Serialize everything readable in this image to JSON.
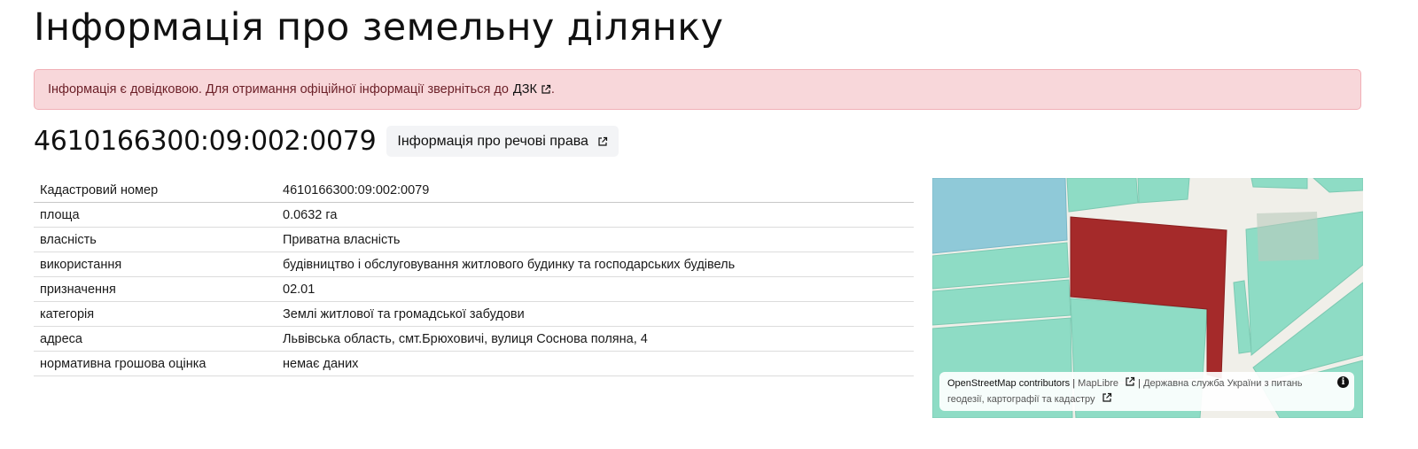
{
  "page": {
    "title": "Інформація про земельну ділянку"
  },
  "alert": {
    "text": "Інформація є довідковою. Для отримання офіційної інформації зверніться до",
    "link_label": "ДЗК",
    "suffix": "."
  },
  "parcel": {
    "cadastral_title": "4610166300:09:002:0079",
    "rights_button_label": "Інформація про речові права"
  },
  "info_table": [
    {
      "key": "Кадастровий номер",
      "value": "4610166300:09:002:0079"
    },
    {
      "key": "площа",
      "value": "0.0632 га"
    },
    {
      "key": "власність",
      "value": "Приватна власність"
    },
    {
      "key": "використання",
      "value": "будівництво і обслуговування житлового будинку та господарських будівель"
    },
    {
      "key": "призначення",
      "value": "02.01"
    },
    {
      "key": "категорія",
      "value": "Землі житлової та громадської забудови"
    },
    {
      "key": "адреса",
      "value": "Львівська область, смт.Брюховичі, вулиця Соснова поляна, 4"
    },
    {
      "key": "нормативна грошова оцінка",
      "value": "немає даних"
    }
  ],
  "map": {
    "attribution": {
      "osm": "OpenStreetMap contributors",
      "sep1": "|",
      "maplibre": "MapLibre",
      "sep2": "|",
      "dgk": "Державна служба України з питань геодезії, картографії та кадастру"
    },
    "colors": {
      "selected_parcel": "#a52a2a",
      "parcel_fill": "#8edcc5",
      "water": "#8fc9d8",
      "background": "#f0efe9"
    }
  },
  "icons": {
    "external_link": "external-link-icon",
    "info": "info-icon"
  }
}
